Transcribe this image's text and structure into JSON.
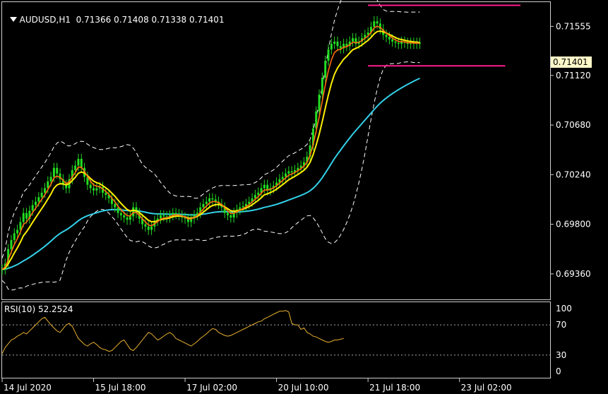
{
  "header": {
    "symbol": "AUDUSD,H1",
    "ohlc": "0.71366 0.71408 0.71338 0.71401"
  },
  "current_price": "0.71401",
  "rsi_header": "RSI(10) 52.2524",
  "colors": {
    "candle": "#22dd22",
    "ema_fast": "#ff6a10",
    "ema_mid": "#ffee00",
    "ema_slow": "#33d0e8",
    "bands": "#ffffff",
    "resistance": "#ff1a8c",
    "rsi": "#e8b030"
  },
  "chart_data": [
    {
      "type": "line",
      "title": "AUDUSD,H1",
      "ylim": [
        0.6914,
        0.7177
      ],
      "y_ticks": [
        "0.71555",
        "0.71120",
        "0.70680",
        "0.70240",
        "0.69800",
        "0.69360"
      ],
      "x_ticks": [
        "14 Jul 2020",
        "15 Jul 18:00",
        "17 Jul 02:00",
        "20 Jul 10:00",
        "21 Jul 18:00",
        "23 Jul 02:00"
      ],
      "x_tick_bars": [
        0,
        30,
        60,
        90,
        120,
        150
      ],
      "total_bars": 152,
      "resistance_lines": [
        {
          "level": 0.71742,
          "from_bar": 120,
          "to_bar": 170
        },
        {
          "level": 0.71205,
          "from_bar": 120,
          "to_bar": 165
        }
      ],
      "series": [
        {
          "name": "close",
          "values": [
            0.694,
            0.6945,
            0.6958,
            0.6966,
            0.6972,
            0.6975,
            0.6982,
            0.699,
            0.6985,
            0.6992,
            0.6997,
            0.7,
            0.7004,
            0.7008,
            0.7012,
            0.7018,
            0.7022,
            0.703,
            0.7025,
            0.702,
            0.7015,
            0.7012,
            0.702,
            0.7028,
            0.7032,
            0.7038,
            0.703,
            0.7022,
            0.7015,
            0.7012,
            0.701,
            0.7012,
            0.7013,
            0.7008,
            0.7006,
            0.7003,
            0.6998,
            0.6995,
            0.699,
            0.6988,
            0.6986,
            0.6984,
            0.6987,
            0.6995,
            0.699,
            0.6985,
            0.698,
            0.6978,
            0.6975,
            0.6978,
            0.6983,
            0.6985,
            0.6988,
            0.6987,
            0.6986,
            0.6988,
            0.699,
            0.6989,
            0.6988,
            0.6986,
            0.6985,
            0.6982,
            0.6985,
            0.6988,
            0.699,
            0.6995,
            0.6998,
            0.7,
            0.7003,
            0.7002,
            0.7,
            0.6998,
            0.6995,
            0.699,
            0.6988,
            0.6986,
            0.699,
            0.6993,
            0.6995,
            0.6996,
            0.6998,
            0.7,
            0.7003,
            0.7006,
            0.7008,
            0.7012,
            0.7015,
            0.701,
            0.7012,
            0.7014,
            0.7017,
            0.702,
            0.7022,
            0.7025,
            0.7027,
            0.7026,
            0.7028,
            0.703,
            0.7032,
            0.7035,
            0.704,
            0.705,
            0.7065,
            0.708,
            0.7095,
            0.711,
            0.7125,
            0.7135,
            0.714,
            0.7142,
            0.7138,
            0.7136,
            0.714,
            0.7138,
            0.7142,
            0.7145,
            0.714,
            0.7142,
            0.7145,
            0.7148,
            0.715,
            0.7155,
            0.716,
            0.7158,
            0.7153,
            0.7148,
            0.7146,
            0.7144,
            0.7142,
            0.7141,
            0.714,
            0.7142,
            0.7141,
            0.714,
            0.7141,
            0.714,
            0.7141,
            0.714
          ]
        },
        {
          "name": "rsi",
          "values": [
            32,
            40,
            45,
            50,
            52,
            55,
            57,
            60,
            58,
            62,
            66,
            70,
            74,
            78,
            80,
            75,
            70,
            66,
            62,
            60,
            65,
            70,
            72,
            68,
            60,
            52,
            48,
            44,
            42,
            45,
            47,
            44,
            40,
            38,
            37,
            35,
            36,
            40,
            44,
            48,
            50,
            44,
            38,
            36,
            40,
            45,
            50,
            55,
            60,
            58,
            54,
            50,
            52,
            55,
            58,
            60,
            57,
            52,
            50,
            48,
            46,
            44,
            42,
            45,
            48,
            52,
            55,
            58,
            62,
            65,
            64,
            60,
            58,
            56,
            55,
            56,
            58,
            60,
            62,
            64,
            66,
            68,
            70,
            72,
            74,
            75,
            78,
            80,
            82,
            84,
            86,
            88,
            88,
            89,
            87,
            72,
            70,
            70,
            64,
            66,
            60,
            58,
            55,
            54,
            52,
            50,
            48,
            47,
            48,
            50,
            50,
            51,
            52
          ]
        }
      ],
      "rsi": {
        "ylim": [
          0,
          100
        ],
        "y_ticks": [
          "100",
          "70",
          "30",
          "0"
        ],
        "levels": [
          70,
          30
        ]
      }
    }
  ]
}
